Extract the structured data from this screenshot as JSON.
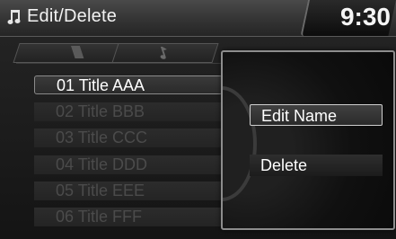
{
  "header": {
    "title": "Edit/Delete",
    "clock": "9:30"
  },
  "tabs": [
    {
      "icon": "disc-icon"
    },
    {
      "icon": "music-note-icon"
    }
  ],
  "list": {
    "items": [
      {
        "label": "01 Title  AAA",
        "selected": true
      },
      {
        "label": "02 Title  BBB",
        "selected": false
      },
      {
        "label": "03 Title  CCC",
        "selected": false
      },
      {
        "label": "04 Title  DDD",
        "selected": false
      },
      {
        "label": "05 Title  EEE",
        "selected": false
      },
      {
        "label": "06 Title  FFF",
        "selected": false
      }
    ]
  },
  "popup": {
    "options": [
      {
        "label": "Edit Name",
        "highlighted": true
      },
      {
        "label": "Delete",
        "highlighted": false
      }
    ]
  }
}
